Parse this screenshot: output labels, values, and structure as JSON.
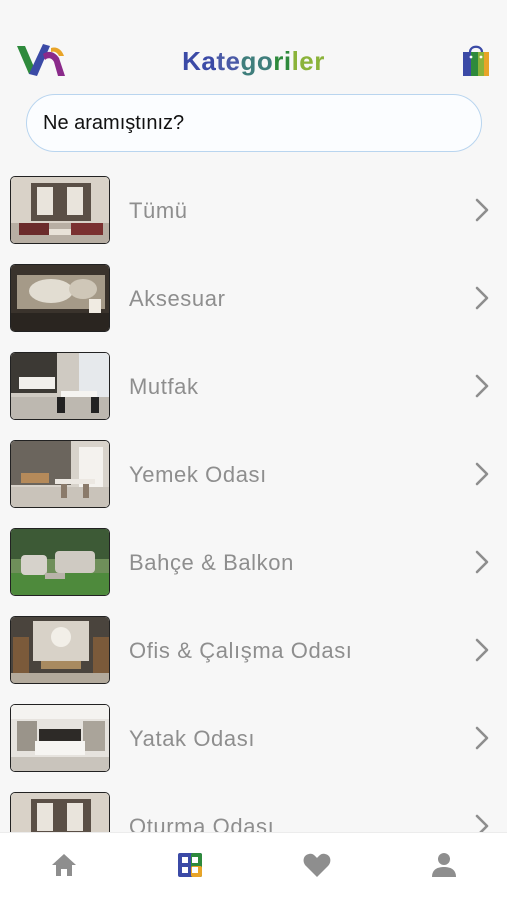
{
  "header": {
    "title_parts": [
      "Ka",
      "te",
      "go",
      "ri",
      "ler"
    ],
    "title_colors": [
      "#3b4aa6",
      "#3b4aa6",
      "#3f7e7c",
      "#2e8a3c",
      "#8bb33a"
    ]
  },
  "search": {
    "placeholder": "Ne aramıştınız?"
  },
  "categories": [
    {
      "label": "Tümü"
    },
    {
      "label": "Aksesuar"
    },
    {
      "label": "Mutfak"
    },
    {
      "label": "Yemek Odası"
    },
    {
      "label": "Bahçe & Balkon"
    },
    {
      "label": "Ofis & Çalışma Odası"
    },
    {
      "label": "Yatak Odası"
    },
    {
      "label": "Oturma Odası"
    }
  ],
  "tabs": [
    {
      "icon": "home-icon",
      "active": false
    },
    {
      "icon": "categories-icon",
      "active": true
    },
    {
      "icon": "heart-icon",
      "active": false
    },
    {
      "icon": "profile-icon",
      "active": false
    }
  ],
  "colors": {
    "tab_inactive": "#8e8e8e",
    "tab_active_a": "#3b4aa6",
    "tab_active_b": "#e8a428",
    "label": "#8e8e8e"
  }
}
